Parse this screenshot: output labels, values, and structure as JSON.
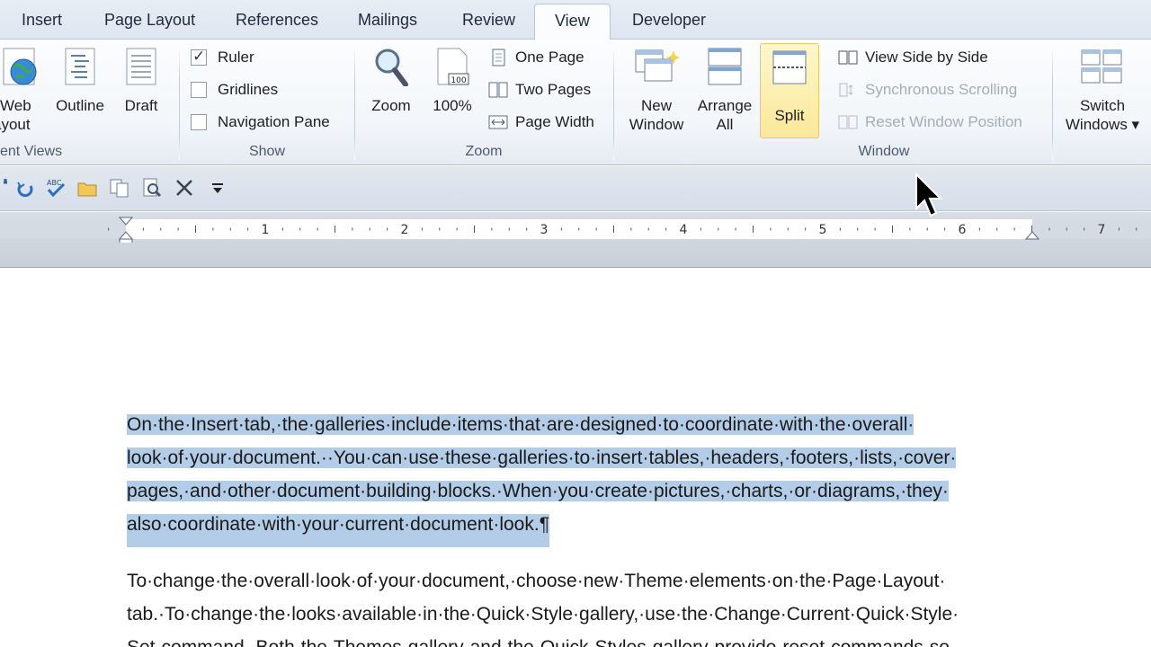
{
  "tabs": {
    "insert": "Insert",
    "page_layout": "Page Layout",
    "references": "References",
    "mailings": "Mailings",
    "review": "Review",
    "view": "View",
    "developer": "Developer"
  },
  "ribbon": {
    "document_views": {
      "label": "ent Views",
      "web_layout_1": "Web",
      "web_layout_2": "ayout",
      "outline": "Outline",
      "draft": "Draft"
    },
    "show": {
      "label": "Show",
      "ruler": "Ruler",
      "ruler_checked": true,
      "gridlines": "Gridlines",
      "navigation_pane": "Navigation Pane"
    },
    "zoom": {
      "label": "Zoom",
      "zoom": "Zoom",
      "percent": "100%",
      "one_page": "One Page",
      "two_pages": "Two Pages",
      "page_width": "Page Width"
    },
    "window": {
      "label": "Window",
      "new_window_1": "New",
      "new_window_2": "Window",
      "arrange_all_1": "Arrange",
      "arrange_all_2": "All",
      "split": "Split",
      "view_side_by_side": "View Side by Side",
      "synchronous_scrolling": "Synchronous Scrolling",
      "reset_window_position": "Reset Window Position",
      "switch_windows_1": "Switch",
      "switch_windows_2": "Windows ▾"
    }
  },
  "ruler": {
    "numbers": [
      "1",
      "2",
      "3",
      "4",
      "5",
      "6",
      "7"
    ]
  },
  "document": {
    "para1": [
      "On·the·Insert·tab,·the·galleries·include·items·that·are·designed·to·coordinate·with·the·overall·",
      "look·of·your·document.··You·can·use·these·galleries·to·insert·tables,·headers,·footers,·lists,·cover·",
      "pages,·and·other·document·building·blocks.·When·you·create·pictures,·charts,·or·diagrams,·they·",
      "also·coordinate·with·your·current·document·look.¶"
    ],
    "para2": [
      "To·change·the·overall·look·of·your·document,·choose·new·Theme·elements·on·the·Page·Layout·",
      "tab.·To·change·the·looks·available·in·the·Quick·Style·gallery,·use·the·Change·Current·Quick·Style·",
      "Set·command.·Both·the·Themes·gallery·and·the·Quick·Styles·gallery·provide·reset·commands·so·"
    ]
  },
  "colors": {
    "selection": "#b3cde8",
    "split_highlight": "#fbe89a"
  }
}
